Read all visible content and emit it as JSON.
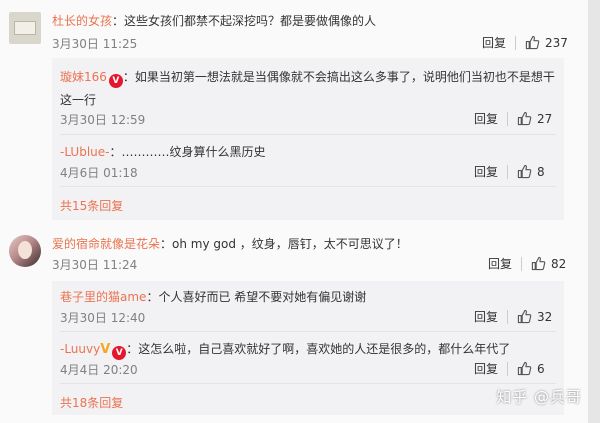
{
  "comments": [
    {
      "user": "杜长的女孩",
      "text": "：这些女孩们都禁不起深挖吗？都是要做偶像的人",
      "time": "3月30日 11:25",
      "reply": "回复",
      "likes": "237",
      "subs": [
        {
          "user": "璇妹166",
          "text_line1": "：如果当初第一想法就是当偶像就不会搞出这么多事了，说明他们当初也不是想干",
          "text_line2": "这一行",
          "time": "3月30日 12:59",
          "reply": "回复",
          "likes": "27"
        },
        {
          "user": "-LUblue-",
          "text": "：…………纹身算什么黑历史",
          "time": "4月6日 01:18",
          "reply": "回复",
          "likes": "8"
        }
      ],
      "more": "共15条回复"
    },
    {
      "user": "爱的宿命就像是花朵",
      "text": "：oh my god ，纹身，唇钉，太不可思议了！",
      "time": "3月30日 11:24",
      "reply": "回复",
      "likes": "82",
      "subs": [
        {
          "user": "巷子里的猫ame",
          "text": "：个人喜好而已 希望不要对她有偏见谢谢",
          "time": "3月30日 12:40",
          "reply": "回复",
          "likes": "32"
        },
        {
          "user": "-Luuvy",
          "text": "：这怎么啦，自己喜欢就好了啊，喜欢她的人还是很多的，都什么年代了",
          "time": "4月4日 20:20",
          "reply": "回复",
          "likes": "6"
        }
      ],
      "more": "共18条回复"
    }
  ],
  "badges": {
    "vip": "V",
    "v_mark": "V"
  },
  "watermark": "知乎 @兵哥",
  "colors": {
    "username": "#eb7350",
    "sub_bg": "#f2f2f5",
    "page_bg": "#fafafa"
  }
}
